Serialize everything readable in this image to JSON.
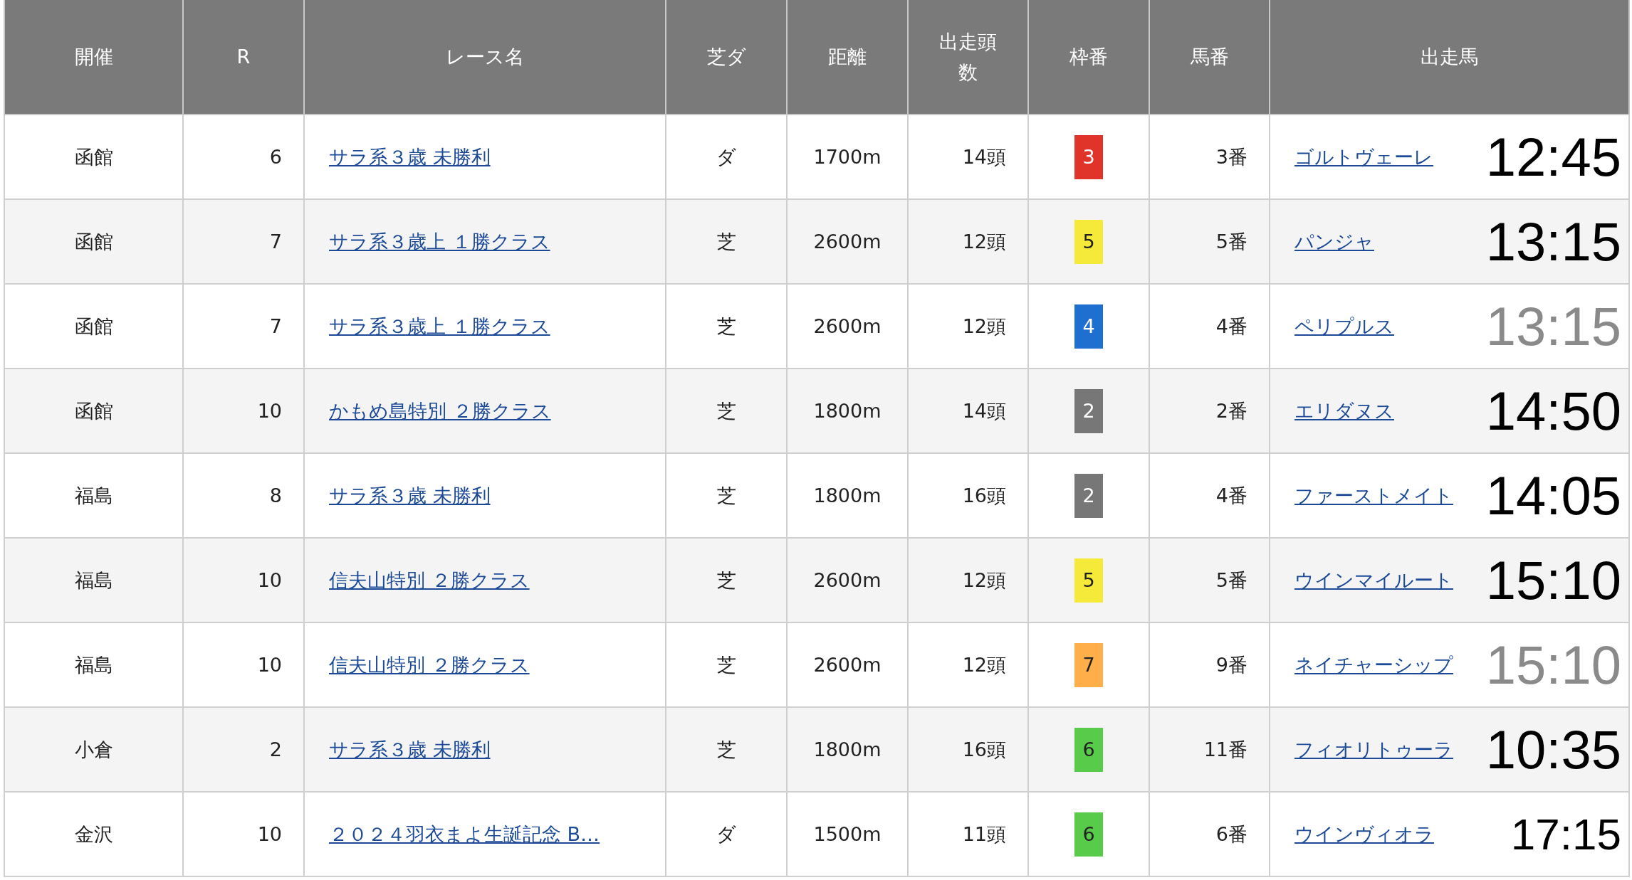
{
  "table": {
    "columns": [
      "開催",
      "R",
      "レース名",
      "芝ダ",
      "距離",
      "出走頭数",
      "枠番",
      "馬番",
      "出走馬"
    ],
    "rows": [
      {
        "venue": "函館",
        "race": "6",
        "race_name": "サラ系３歳 未勝利",
        "surface": "ダ",
        "distance": "1700m",
        "runners": "14頭",
        "frame": "3",
        "color": "#e0342a",
        "number": "3番",
        "horse": "ゴルトヴェーレ",
        "time": "12:45",
        "dimmed": false,
        "large": true
      },
      {
        "venue": "函館",
        "race": "7",
        "race_name": "サラ系３歳上 １勝クラス",
        "surface": "芝",
        "distance": "2600m",
        "runners": "12頭",
        "frame": "5",
        "color": "#f5ea3a",
        "number": "5番",
        "horse": "パンジャ",
        "time": "13:15",
        "dimmed": false,
        "large": true
      },
      {
        "venue": "函館",
        "race": "7",
        "race_name": "サラ系３歳上 １勝クラス",
        "surface": "芝",
        "distance": "2600m",
        "runners": "12頭",
        "frame": "4",
        "color": "#1f6fd0",
        "number": "4番",
        "horse": "ペリプルス",
        "time": "13:15",
        "dimmed": true,
        "large": true
      },
      {
        "venue": "函館",
        "race": "10",
        "race_name": "かもめ島特別 ２勝クラス",
        "surface": "芝",
        "distance": "1800m",
        "runners": "14頭",
        "frame": "2",
        "color": "#777777",
        "number": "2番",
        "horse": "エリダヌス",
        "time": "14:50",
        "dimmed": false,
        "large": true
      },
      {
        "venue": "福島",
        "race": "8",
        "race_name": "サラ系３歳 未勝利",
        "surface": "芝",
        "distance": "1800m",
        "runners": "16頭",
        "frame": "2",
        "color": "#777777",
        "number": "4番",
        "horse": "ファーストメイト",
        "time": "14:05",
        "dimmed": false,
        "large": true
      },
      {
        "venue": "福島",
        "race": "10",
        "race_name": "信夫山特別 ２勝クラス",
        "surface": "芝",
        "distance": "2600m",
        "runners": "12頭",
        "frame": "5",
        "color": "#f5ea3a",
        "number": "5番",
        "horse": "ウインマイルート",
        "time": "15:10",
        "dimmed": false,
        "large": true
      },
      {
        "venue": "福島",
        "race": "10",
        "race_name": "信夫山特別 ２勝クラス",
        "surface": "芝",
        "distance": "2600m",
        "runners": "12頭",
        "frame": "7",
        "color": "#ffae4a",
        "number": "9番",
        "horse": "ネイチャーシップ",
        "time": "15:10",
        "dimmed": true,
        "large": true
      },
      {
        "venue": "小倉",
        "race": "2",
        "race_name": "サラ系３歳 未勝利",
        "surface": "芝",
        "distance": "1800m",
        "runners": "16頭",
        "frame": "6",
        "color": "#58cc4a",
        "number": "11番",
        "horse": "フィオリトゥーラ",
        "time": "10:35",
        "dimmed": false,
        "large": true
      },
      {
        "venue": "金沢",
        "race": "10",
        "race_name": "２０２４羽衣まよ生誕記念 B…",
        "surface": "ダ",
        "distance": "1500m",
        "runners": "11頭",
        "frame": "6",
        "color": "#58cc4a",
        "number": "6番",
        "horse": "ウインヴィオラ",
        "time": "17:15",
        "dimmed": false,
        "large": false
      }
    ]
  }
}
